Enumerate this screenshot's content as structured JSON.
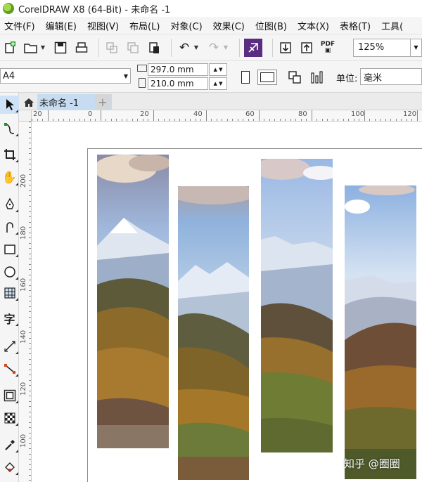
{
  "window": {
    "title": "CorelDRAW X8 (64-Bit) - 未命名 -1"
  },
  "menu": [
    "文件(F)",
    "编辑(E)",
    "视图(V)",
    "布局(L)",
    "对象(C)",
    "效果(C)",
    "位图(B)",
    "文本(X)",
    "表格(T)",
    "工具("
  ],
  "toolbar": {
    "zoom": "125%",
    "pdf_label": "PDF"
  },
  "property_bar": {
    "paper_size": "A4",
    "width": "297.0 mm",
    "height": "210.0 mm",
    "unit_label": "单位:",
    "unit_value": "毫米"
  },
  "document_tab": {
    "label": "未命名 -1"
  },
  "ruler": {
    "horizontal": [
      "20",
      "0",
      "20",
      "40",
      "60",
      "80",
      "100",
      "120"
    ],
    "vertical": [
      "200",
      "180",
      "160",
      "140",
      "120",
      "100"
    ]
  },
  "watermark": "知乎 @圈圈",
  "colors": {
    "active_tab": "#c7dcf1",
    "accent_purple": "#5a2d82",
    "app_logo": "#7cbb2a"
  }
}
